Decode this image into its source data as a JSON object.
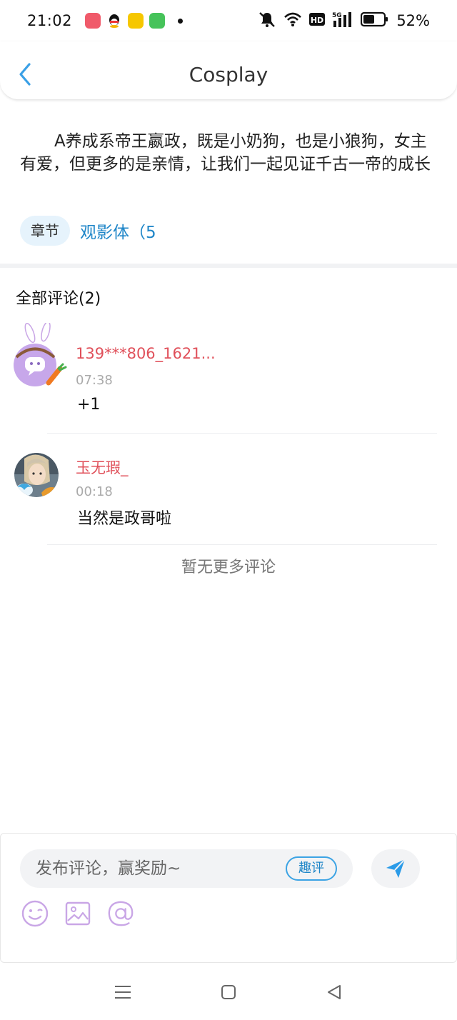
{
  "status_bar": {
    "time": "21:02",
    "battery": "52%",
    "app_icons": [
      "shop-app-icon",
      "qq-icon",
      "fast-app-icon",
      "green-app-icon"
    ]
  },
  "header": {
    "title": "Cosplay"
  },
  "story": {
    "description": "A养成系帝王嬴政，既是小奶狗，也是小狼狗，女主有爱，但更多的是亲情，让我们一起见证千古一帝的成长",
    "chapter_tag": "章节",
    "chapter_link": "观影体（5"
  },
  "comments": {
    "heading": "全部评论(2)",
    "items": [
      {
        "name": "139***806_1621...",
        "time": "07:38",
        "text": "+1"
      },
      {
        "name": "玉无瑕_",
        "time": "00:18",
        "text": "当然是政哥啦"
      }
    ],
    "no_more": "暂无更多评论"
  },
  "composer": {
    "placeholder": "发布评论，赢奖励~",
    "qp_label": "趣评"
  },
  "colors": {
    "accent_blue": "#1f86c8",
    "username_red": "#e0505a",
    "icon_purple": "#c9a6e6"
  }
}
